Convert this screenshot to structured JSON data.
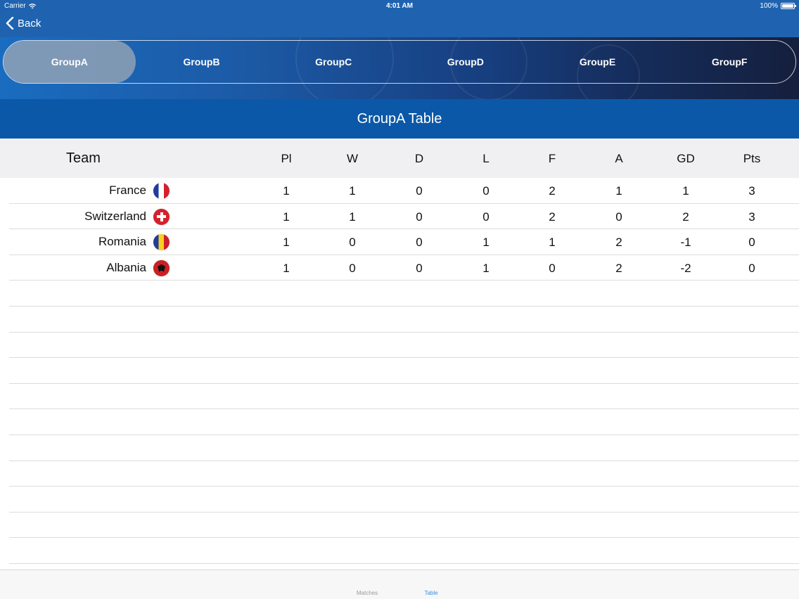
{
  "status": {
    "carrier": "Carrier",
    "time": "4:01 AM",
    "battery": "100%"
  },
  "nav": {
    "back_label": "Back"
  },
  "groups": {
    "items": [
      "GroupA",
      "GroupB",
      "GroupC",
      "GroupD",
      "GroupE",
      "GroupF"
    ],
    "selected": "GroupA"
  },
  "table": {
    "title": "GroupA Table",
    "headers": {
      "team": "Team",
      "pl": "Pl",
      "w": "W",
      "d": "D",
      "l": "L",
      "f": "F",
      "a": "A",
      "gd": "GD",
      "pts": "Pts"
    },
    "rows": [
      {
        "team": "France",
        "flag": "france-flag-icon",
        "pl": "1",
        "w": "1",
        "d": "0",
        "l": "0",
        "f": "2",
        "a": "1",
        "gd": "1",
        "pts": "3"
      },
      {
        "team": "Switzerland",
        "flag": "switzerland-flag-icon",
        "pl": "1",
        "w": "1",
        "d": "0",
        "l": "0",
        "f": "2",
        "a": "0",
        "gd": "2",
        "pts": "3"
      },
      {
        "team": "Romania",
        "flag": "romania-flag-icon",
        "pl": "1",
        "w": "0",
        "d": "0",
        "l": "1",
        "f": "1",
        "a": "2",
        "gd": "-1",
        "pts": "0"
      },
      {
        "team": "Albania",
        "flag": "albania-flag-icon",
        "pl": "1",
        "w": "0",
        "d": "0",
        "l": "1",
        "f": "0",
        "a": "2",
        "gd": "-2",
        "pts": "0"
      }
    ]
  },
  "tabbar": {
    "items": [
      "Matches",
      "Table"
    ],
    "selected": "Table"
  },
  "colors": {
    "nav_blue": "#1f63b0",
    "title_blue": "#0b58a8",
    "active_tab": "#3b8ede"
  }
}
